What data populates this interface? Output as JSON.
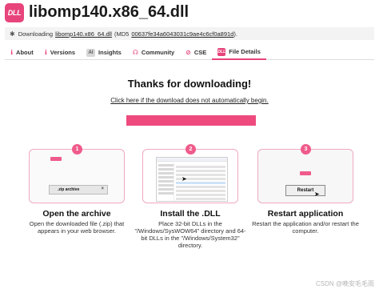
{
  "header": {
    "logo_text": "DLL",
    "title": "libomp140.x86_64.dll"
  },
  "download_bar": {
    "prefix": "Downloading",
    "file_link": "libomp140.x86_64.dll",
    "md5_label": "(MD5",
    "md5_value": "00637fe34a6043031c9ae4c6cf0a891d",
    "md5_close": ")."
  },
  "tabs": [
    {
      "icon": "info-icon",
      "label": "About"
    },
    {
      "icon": "versions-icon",
      "label": "Versions"
    },
    {
      "icon": "ai-icon",
      "icon_text": "AI",
      "label": "Insights"
    },
    {
      "icon": "community-icon",
      "label": "Community"
    },
    {
      "icon": "cse-icon",
      "label": "CSE"
    },
    {
      "icon": "dll-icon",
      "icon_text": "DLL",
      "label": "File Details"
    }
  ],
  "main": {
    "thanks": "Thanks for downloading!",
    "click_here": "Click here if the download does not automatically begin.",
    "progress_fraction": 1.0,
    "accent_color": "#ee4a7e"
  },
  "steps": [
    {
      "number": "1",
      "mini_tag": "DLLs.com",
      "zip_label": ".zip archive",
      "title": "Open the archive",
      "desc": "Open the downloaded file (.zip) that appears in your web browser."
    },
    {
      "number": "2",
      "title": "Install the .DLL",
      "desc": "Place 32-bit DLLs in the \"/Windows/SysWOW64\" directory and 64-bit DLLs in the \"/Windows/System32\" directory."
    },
    {
      "number": "3",
      "mini_tag": "DLLs.com",
      "button_label": "Restart",
      "title": "Restart application",
      "desc": "Restart the application and/or restart the computer."
    }
  ],
  "watermark": "CSDN @晚安毛毛雨"
}
